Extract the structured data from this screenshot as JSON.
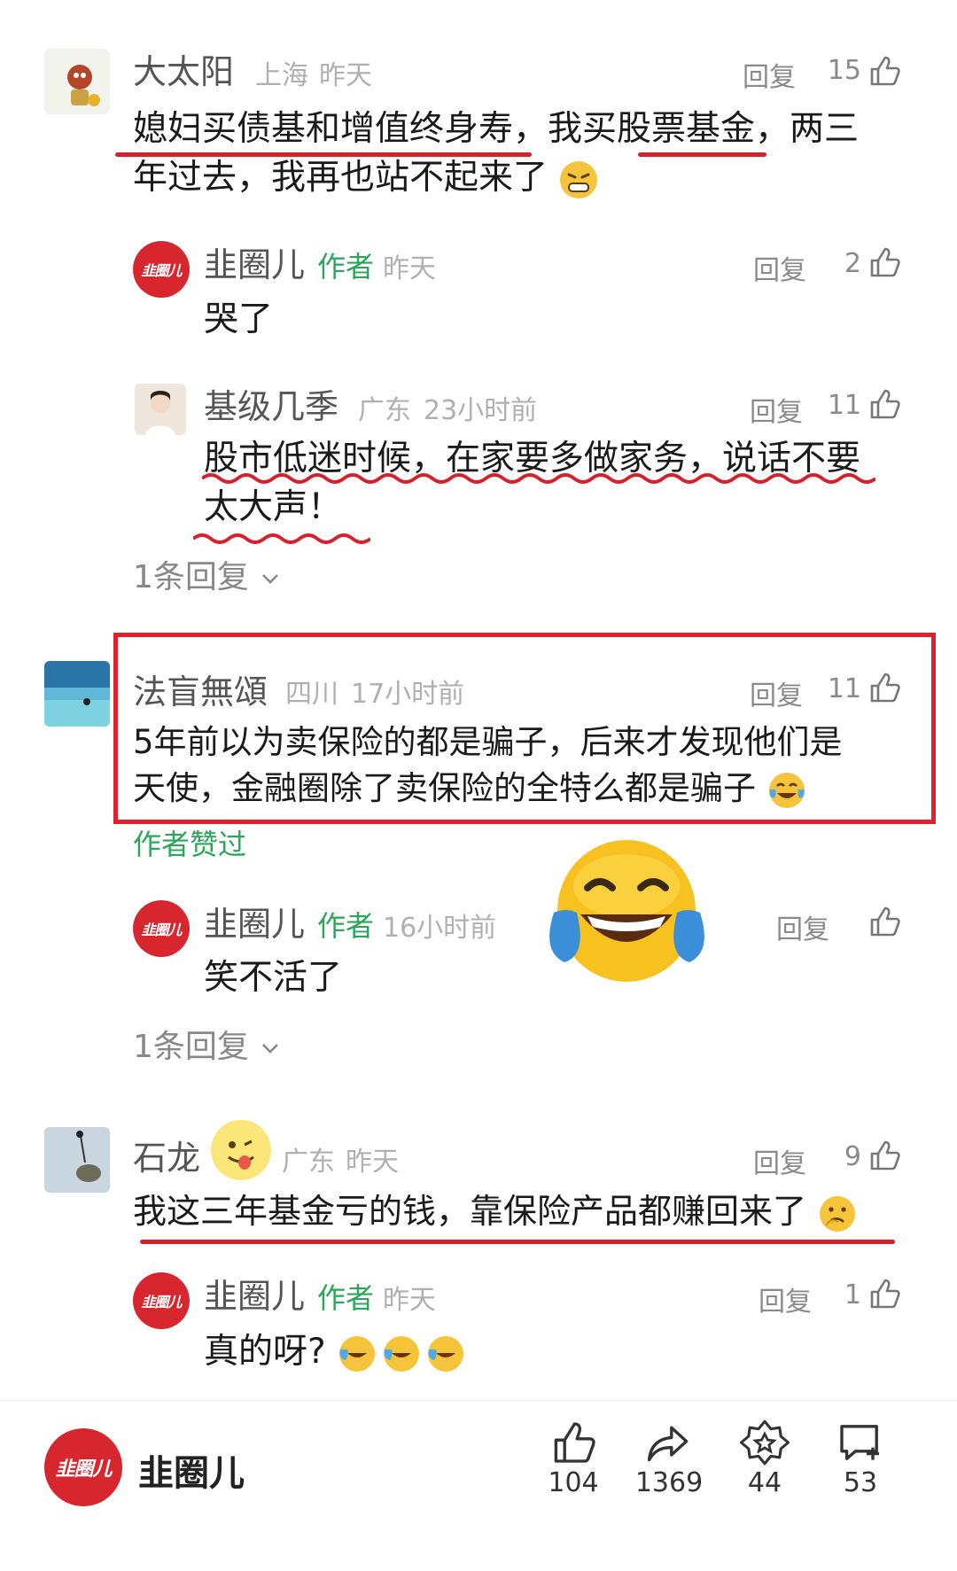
{
  "comments": [
    {
      "user": "大太阳",
      "location": "上海",
      "time": "昨天",
      "reply_label": "回复",
      "likes": "15",
      "text_line1": "媳妇买债基和增值终身寿，我买股票基金，两三",
      "text_line2": "年过去，我再也站不起来了"
    },
    {
      "user": "韭圈儿",
      "author_tag": "作者",
      "time": "昨天",
      "reply_label": "回复",
      "likes": "2",
      "text": "哭了"
    },
    {
      "user": "基级几季",
      "location": "广东",
      "time": "23小时前",
      "reply_label": "回复",
      "likes": "11",
      "text_line1": "股市低迷时候，在家要多做家务，说话不要",
      "text_line2": "太大声！"
    },
    {
      "user": "法盲無頌",
      "location": "四川",
      "time": "17小时前",
      "reply_label": "回复",
      "likes": "11",
      "text_line1": "5年前以为卖保险的都是骗子，后来才发现他们是",
      "text_line2": "天使，金融圈除了卖保险的全特么都是骗子",
      "author_liked": "作者赞过"
    },
    {
      "user": "韭圈儿",
      "author_tag": "作者",
      "time": "16小时前",
      "reply_label": "回复",
      "text": "笑不活了"
    },
    {
      "user": "石龙",
      "location": "广东",
      "time": "昨天",
      "reply_label": "回复",
      "likes": "9",
      "text": "我这三年基金亏的钱，靠保险产品都赚回来了"
    },
    {
      "user": "韭圈儿",
      "author_tag": "作者",
      "time": "昨天",
      "reply_label": "回复",
      "likes": "1",
      "text": "真的呀?"
    }
  ],
  "more_replies": [
    "1条回复",
    "1条回复"
  ],
  "logo_text": "韭圈儿",
  "bottom": {
    "account_name": "韭圈儿",
    "like_count": "104",
    "share_count": "1369",
    "collect_count": "44",
    "comment_count": "53"
  },
  "icons": {
    "like": "thumbs-up-icon",
    "share": "share-arrow-icon",
    "collect": "star-badge-icon",
    "comment": "comment-plus-icon",
    "chevron": "chevron-down-icon"
  },
  "colors": {
    "brand_red": "#d7262e",
    "author_green": "#2aa55a",
    "highlight_red": "#e0202a"
  }
}
